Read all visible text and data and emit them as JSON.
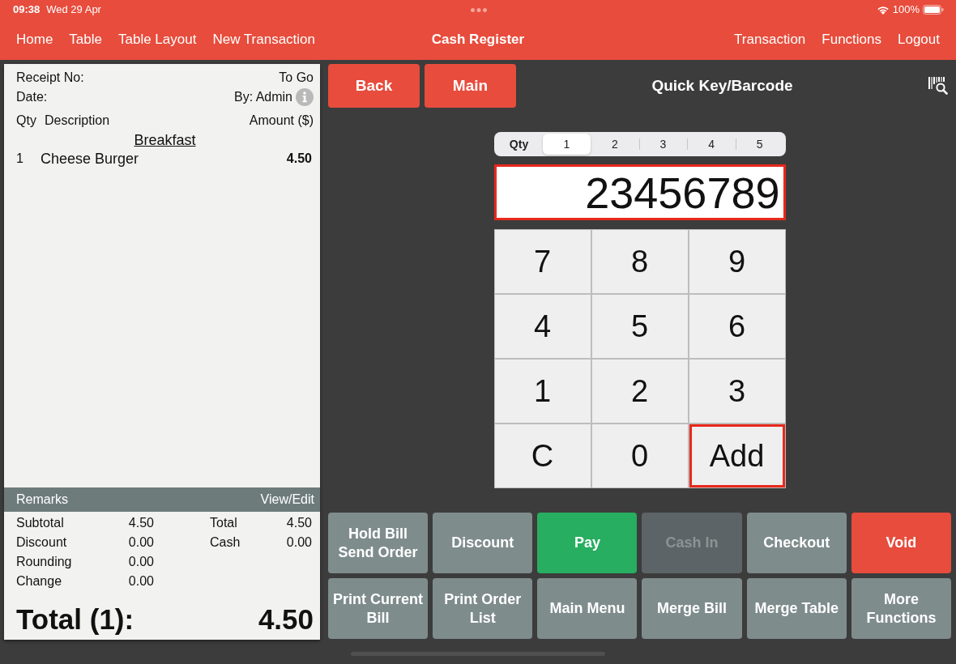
{
  "status_bar": {
    "time": "09:38",
    "date": "Wed 29 Apr",
    "battery": "100%"
  },
  "navigation": {
    "left_links": [
      "Home",
      "Table",
      "Table Layout",
      "New Transaction"
    ],
    "title": "Cash Register",
    "right_links": [
      "Transaction",
      "Functions",
      "Logout"
    ]
  },
  "receipt": {
    "info_rows": [
      {
        "label": "Receipt No:",
        "value": "To Go",
        "info_button": false
      },
      {
        "label": "Date:",
        "value": "By: Admin",
        "info_button": true
      }
    ],
    "columns": [
      "Qty",
      "Description",
      "Amount ($)"
    ],
    "groups": [
      {
        "name": "Breakfast",
        "items": [
          {
            "qty": "1",
            "description": "Cheese Burger",
            "amount": "4.50"
          }
        ]
      }
    ],
    "remarks": {
      "label": "Remarks",
      "action": "View/Edit"
    },
    "summary_left": [
      {
        "label": "Subtotal",
        "value": "4.50"
      },
      {
        "label": "Discount",
        "value": "0.00"
      },
      {
        "label": "Rounding",
        "value": "0.00"
      },
      {
        "label": "Change",
        "value": "0.00"
      }
    ],
    "summary_right": [
      {
        "label": "Total",
        "value": "4.50"
      },
      {
        "label": "Cash",
        "value": "0.00"
      }
    ],
    "total": {
      "label": "Total (1):",
      "value": "4.50"
    }
  },
  "toolbar": {
    "buttons": [
      "Back",
      "Main"
    ],
    "title": "Quick Key/Barcode"
  },
  "qty_selector": {
    "label": "Qty",
    "options": [
      {
        "label": "1",
        "selected": true
      },
      {
        "label": "2",
        "selected": false
      },
      {
        "label": "3",
        "selected": false
      },
      {
        "label": "4",
        "selected": false
      },
      {
        "label": "5",
        "selected": false
      }
    ]
  },
  "barcode_field": {
    "value": "23456789"
  },
  "keypad": {
    "keys": [
      {
        "label": "7",
        "highlighted": false
      },
      {
        "label": "8",
        "highlighted": false
      },
      {
        "label": "9",
        "highlighted": false
      },
      {
        "label": "4",
        "highlighted": false
      },
      {
        "label": "5",
        "highlighted": false
      },
      {
        "label": "6",
        "highlighted": false
      },
      {
        "label": "1",
        "highlighted": false
      },
      {
        "label": "2",
        "highlighted": false
      },
      {
        "label": "3",
        "highlighted": false
      },
      {
        "label": "C",
        "highlighted": false
      },
      {
        "label": "0",
        "highlighted": false
      },
      {
        "label": "Add",
        "highlighted": true
      }
    ]
  },
  "actions": [
    {
      "label": "Hold Bill Send Order",
      "kind": "default",
      "disabled": false
    },
    {
      "label": "Discount",
      "kind": "default",
      "disabled": false
    },
    {
      "label": "Pay",
      "kind": "success",
      "disabled": false
    },
    {
      "label": "Cash In",
      "kind": "default",
      "disabled": true
    },
    {
      "label": "Checkout",
      "kind": "default",
      "disabled": false
    },
    {
      "label": "Void",
      "kind": "danger",
      "disabled": false
    },
    {
      "label": "Print Current Bill",
      "kind": "default",
      "disabled": false
    },
    {
      "label": "Print Order List",
      "kind": "default",
      "disabled": false
    },
    {
      "label": "Main Menu",
      "kind": "default",
      "disabled": false
    },
    {
      "label": "Merge Bill",
      "kind": "default",
      "disabled": false
    },
    {
      "label": "Merge Table",
      "kind": "default",
      "disabled": false
    },
    {
      "label": "More Functions",
      "kind": "default",
      "disabled": false
    }
  ]
}
